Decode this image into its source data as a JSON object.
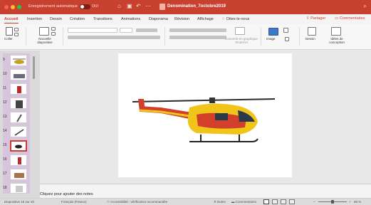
{
  "titlebar": {
    "autosave_label": "Enregistrement automatique",
    "toggle_label": "OUI",
    "document_title": "Denomination_7octobre2019",
    "colors": {
      "bar": "#c8412f",
      "close": "#ff5f57",
      "minimize": "#febc2e",
      "zoom": "#28c840"
    }
  },
  "tabs": [
    "Accueil",
    "Insertion",
    "Dessin",
    "Création",
    "Transitions",
    "Animations",
    "Diaporama",
    "Révision",
    "Affichage",
    "Dites-le-nous"
  ],
  "share_label": "Partager",
  "comments_label": "Commentaires",
  "ribbon": {
    "paste_label": "Coller",
    "new_slide_label": "Nouvelle diapositive",
    "convert_label": "Convertir en graphique SmartArt",
    "image_label": "Image",
    "drawing_label": "Dessin",
    "design_ideas_label": "Idées de conception"
  },
  "slides": [
    {
      "number": "9",
      "icon": "helicopter-thumbnail"
    },
    {
      "number": "10",
      "icon": "truck-thumbnail"
    },
    {
      "number": "11",
      "icon": "hydrant-thumbnail"
    },
    {
      "number": "12",
      "icon": "building-thumbnail"
    },
    {
      "number": "13",
      "icon": "tool-thumbnail"
    },
    {
      "number": "14",
      "icon": "hose-thumbnail"
    },
    {
      "number": "15",
      "icon": "helicopter-thumbnail",
      "selected": true
    },
    {
      "number": "16",
      "icon": "extinguisher-thumbnail"
    },
    {
      "number": "17",
      "icon": "ladder-thumbnail"
    },
    {
      "number": "18",
      "icon": "fire-thumbnail"
    }
  ],
  "notes_placeholder": "Cliquez pour ajouter des notes",
  "status": {
    "slide_position": "Diapositive 15 sur 40",
    "language": "Français (France)",
    "accessibility": "Accessibilité : vérification recommandée",
    "notes_button": "Notes",
    "comments_button": "Commentaires",
    "zoom": "66 %"
  }
}
